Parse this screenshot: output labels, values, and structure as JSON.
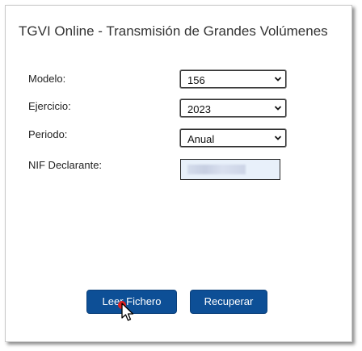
{
  "dialog": {
    "title": "TGVI Online - Transmisión de Grandes Volúmenes"
  },
  "form": {
    "modelo": {
      "label": "Modelo:",
      "value": "156"
    },
    "ejercicio": {
      "label": "Ejercicio:",
      "value": "2023"
    },
    "periodo": {
      "label": "Periodo:",
      "value": "Anual"
    },
    "nif": {
      "label": "NIF Declarante:",
      "value": ""
    }
  },
  "buttons": {
    "leer_fichero": "Leer Fichero",
    "recuperar": "Recuperar"
  },
  "colors": {
    "button_bg": "#0d4f96",
    "input_bg": "#e8f0fa",
    "click_indicator": "#e02020"
  },
  "icons": {
    "select_arrow": "chevron-down-icon",
    "pointer": "mouse-pointer-icon"
  }
}
